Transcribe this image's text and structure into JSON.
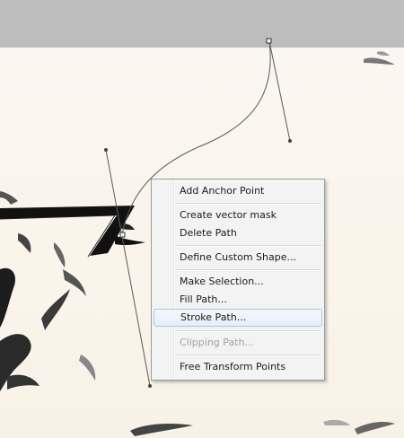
{
  "context_menu": {
    "items": [
      {
        "label": "Add Anchor Point",
        "enabled": true,
        "highlighted": false
      },
      {
        "label": "Create vector mask",
        "enabled": true,
        "highlighted": false
      },
      {
        "label": "Delete Path",
        "enabled": true,
        "highlighted": false
      },
      {
        "label": "Define Custom Shape...",
        "enabled": true,
        "highlighted": false
      },
      {
        "label": "Make Selection...",
        "enabled": true,
        "highlighted": false
      },
      {
        "label": "Fill Path...",
        "enabled": true,
        "highlighted": false
      },
      {
        "label": "Stroke Path...",
        "enabled": true,
        "highlighted": true
      },
      {
        "label": "Clipping Path...",
        "enabled": false,
        "highlighted": false
      },
      {
        "label": "Free Transform Points",
        "enabled": true,
        "highlighted": false
      }
    ]
  },
  "colors": {
    "toolbar_background": "#bdbdbd",
    "canvas_background": "#fbf6ee",
    "menu_background": "#f3f3f3",
    "menu_highlight_border": "#a9c4e6",
    "disabled_text": "#a1a1a1",
    "artwork_ink": "#111111"
  }
}
